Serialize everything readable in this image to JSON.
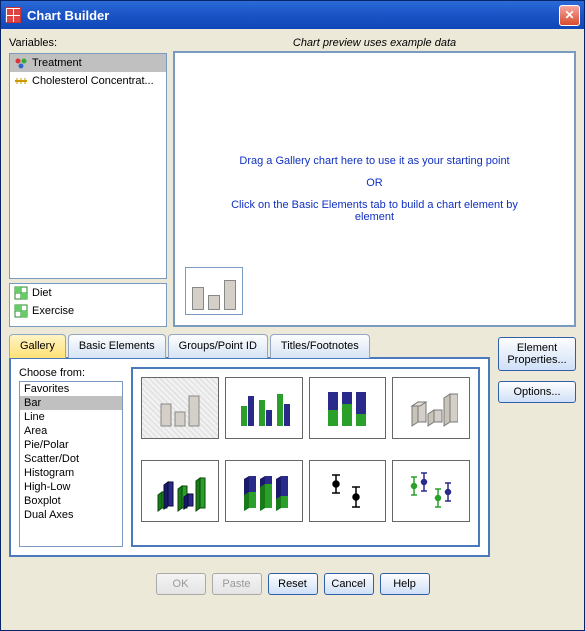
{
  "window": {
    "title": "Chart Builder"
  },
  "labels": {
    "variables": "Variables:",
    "preview": "Chart preview uses example data",
    "choose": "Choose from:"
  },
  "variables_top": [
    {
      "name": "Treatment",
      "icon": "nominal",
      "selected": true
    },
    {
      "name": "Cholesterol Concentrat...",
      "icon": "scale",
      "selected": false
    }
  ],
  "variables_bottom": [
    {
      "name": "Diet",
      "icon": "grid"
    },
    {
      "name": "Exercise",
      "icon": "grid"
    }
  ],
  "preview_text": {
    "line1": "Drag a Gallery chart here to use it as your starting point",
    "or": "OR",
    "line2": "Click on the Basic Elements tab to build a chart element by element"
  },
  "tabs": [
    {
      "label": "Gallery",
      "active": true
    },
    {
      "label": "Basic Elements",
      "active": false
    },
    {
      "label": "Groups/Point ID",
      "active": false
    },
    {
      "label": "Titles/Footnotes",
      "active": false
    }
  ],
  "chart_types": [
    {
      "label": "Favorites",
      "selected": false
    },
    {
      "label": "Bar",
      "selected": true
    },
    {
      "label": "Line",
      "selected": false
    },
    {
      "label": "Area",
      "selected": false
    },
    {
      "label": "Pie/Polar",
      "selected": false
    },
    {
      "label": "Scatter/Dot",
      "selected": false
    },
    {
      "label": "Histogram",
      "selected": false
    },
    {
      "label": "High-Low",
      "selected": false
    },
    {
      "label": "Boxplot",
      "selected": false
    },
    {
      "label": "Dual Axes",
      "selected": false
    }
  ],
  "gallery_thumbs": [
    "simple-bar",
    "clustered-bar",
    "stacked-bar",
    "3d-bar",
    "clustered-3d-bar",
    "stacked-3d-bar",
    "error-bar-1",
    "error-bar-2"
  ],
  "side_buttons": {
    "element_properties": "Element Properties...",
    "options": "Options..."
  },
  "bottom_buttons": {
    "ok": "OK",
    "paste": "Paste",
    "reset": "Reset",
    "cancel": "Cancel",
    "help": "Help"
  }
}
